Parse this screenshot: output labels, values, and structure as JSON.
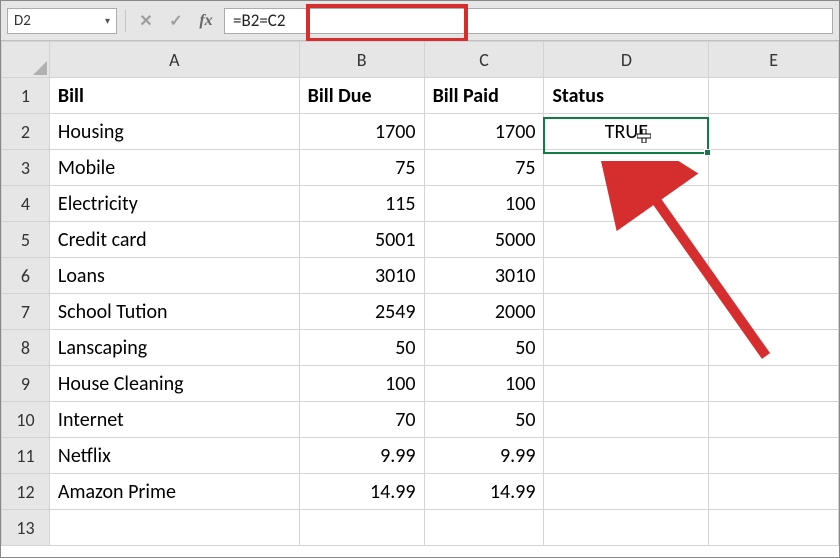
{
  "namebox": "D2",
  "formula": "=B2=C2",
  "icons": {
    "cancel": "✕",
    "enter": "✓",
    "fx": "fx",
    "dropdown": "▾"
  },
  "columns": [
    "A",
    "B",
    "C",
    "D",
    "E"
  ],
  "headers": {
    "A": "Bill",
    "B": "Bill Due",
    "C": "Bill Paid",
    "D": "Status"
  },
  "rows": [
    {
      "a": "Housing",
      "b": "1700",
      "c": "1700",
      "d": "TRUE"
    },
    {
      "a": "Mobile",
      "b": "75",
      "c": "75",
      "d": ""
    },
    {
      "a": "Electricity",
      "b": "115",
      "c": "100",
      "d": ""
    },
    {
      "a": "Credit card",
      "b": "5001",
      "c": "5000",
      "d": ""
    },
    {
      "a": "Loans",
      "b": "3010",
      "c": "3010",
      "d": ""
    },
    {
      "a": "School Tution",
      "b": "2549",
      "c": "2000",
      "d": ""
    },
    {
      "a": "Lanscaping",
      "b": "50",
      "c": "50",
      "d": ""
    },
    {
      "a": "House Cleaning",
      "b": "100",
      "c": "100",
      "d": ""
    },
    {
      "a": "Internet",
      "b": "70",
      "c": "50",
      "d": ""
    },
    {
      "a": "Netflix",
      "b": "9.99",
      "c": "9.99",
      "d": ""
    },
    {
      "a": "Amazon Prime",
      "b": "14.99",
      "c": "14.99",
      "d": ""
    }
  ]
}
